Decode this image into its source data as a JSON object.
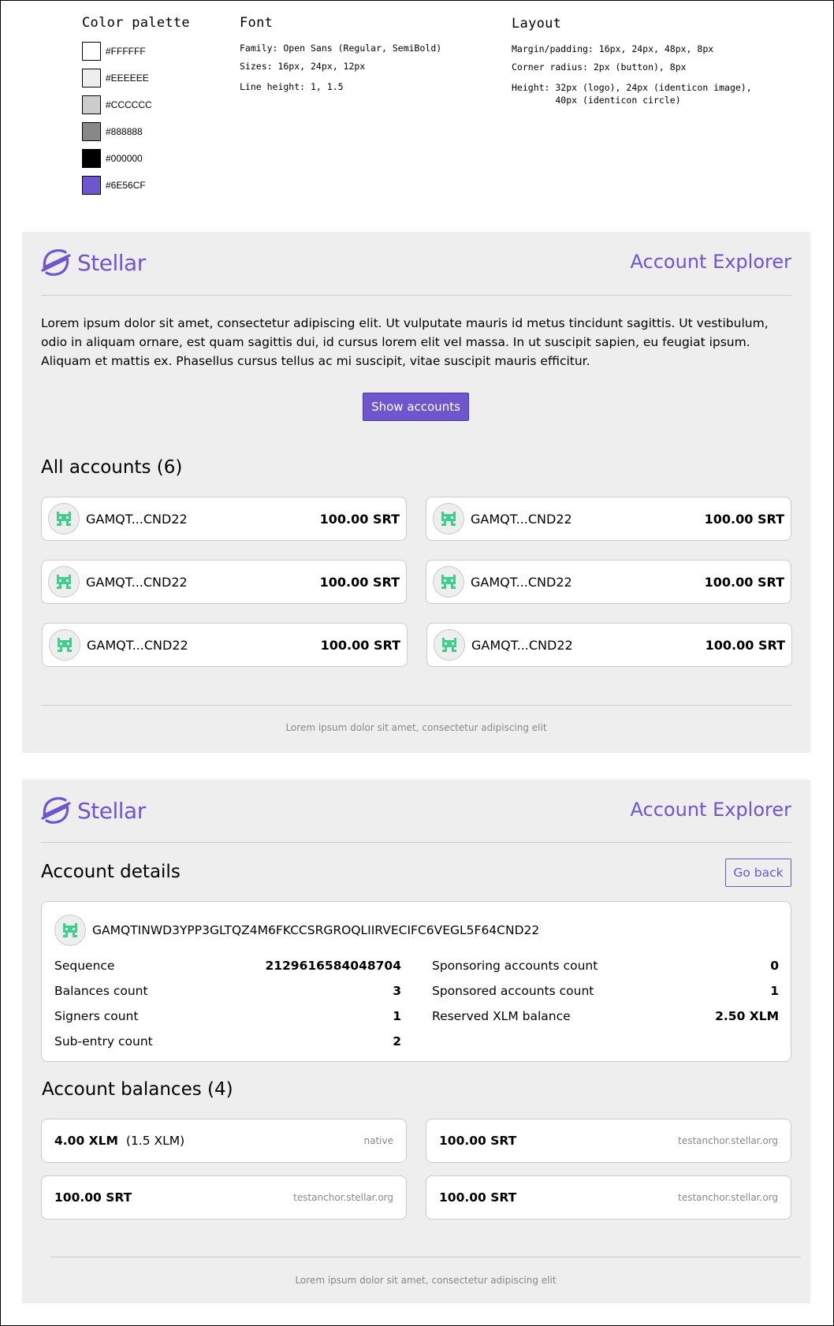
{
  "style_guide": {
    "palette_title": "Color palette",
    "colors": [
      {
        "hex": "#FFFFFF",
        "label": "#FFFFFF"
      },
      {
        "hex": "#EEEEEE",
        "label": "#EEEEEE"
      },
      {
        "hex": "#CCCCCC",
        "label": "#CCCCCC"
      },
      {
        "hex": "#888888",
        "label": "#888888"
      },
      {
        "hex": "#000000",
        "label": "#000000"
      },
      {
        "hex": "#6E56CF",
        "label": "#6E56CF"
      }
    ],
    "font_title": "Font",
    "font_family": "Family: Open Sans (Regular, SemiBold)",
    "font_sizes": "Sizes: 16px, 24px, 12px",
    "font_line_height": "Line height: 1, 1.5",
    "layout_title": "Layout",
    "layout_margin": "Margin/padding: 16px, 24px, 48px, 8px",
    "layout_radius": "Corner radius: 2px (button), 8px",
    "layout_height": "Height: 32px (logo), 24px (identicon image),\n        40px (identicon circle)"
  },
  "brand": {
    "logo_text": "Stellar",
    "app_title": "Account Explorer",
    "accent": "#6e56cf"
  },
  "home": {
    "intro": "Lorem ipsum dolor sit amet, consectetur adipiscing elit. Ut vulputate mauris id metus tincidunt sagittis. Ut vestibulum, odio in aliquam ornare, est quam sagittis dui, id cursus lorem elit vel massa. In ut suscipit sapien, eu feugiat ipsum. Aliquam et mattis ex. Phasellus cursus tellus ac mi suscipit, vitae suscipit mauris efficitur.",
    "show_button": "Show accounts",
    "accounts_heading": "All accounts (6)",
    "accounts": [
      {
        "id": "GAMQT...CND22",
        "balance": "100.00 SRT"
      },
      {
        "id": "GAMQT...CND22",
        "balance": "100.00 SRT"
      },
      {
        "id": "GAMQT...CND22",
        "balance": "100.00 SRT"
      },
      {
        "id": "GAMQT...CND22",
        "balance": "100.00 SRT"
      },
      {
        "id": "GAMQT...CND22",
        "balance": "100.00 SRT"
      },
      {
        "id": "GAMQT...CND22",
        "balance": "100.00 SRT"
      }
    ],
    "footer": "Lorem ipsum dolor sit amet, consectetur adipiscing elit"
  },
  "details": {
    "heading": "Account details",
    "back_button": "Go back",
    "account_id": "GAMQTINWD3YPP3GLTQZ4M6FKCCSRGROQLIIRVECIFC6VEGL5F64CND22",
    "left": [
      {
        "label": "Sequence",
        "value": "2129616584048704"
      },
      {
        "label": "Balances count",
        "value": "3"
      },
      {
        "label": "Signers count",
        "value": "1"
      },
      {
        "label": "Sub-entry count",
        "value": "2"
      }
    ],
    "right": [
      {
        "label": "Sponsoring accounts count",
        "value": "0"
      },
      {
        "label": "Sponsored accounts count",
        "value": "1"
      },
      {
        "label": "Reserved XLM balance",
        "value": "2.50 XLM"
      }
    ],
    "balances_heading": "Account balances (4)",
    "balances": [
      {
        "amount": "4.00 XLM",
        "extra": "(1.5 XLM)",
        "issuer": "native"
      },
      {
        "amount": "100.00 SRT",
        "extra": "",
        "issuer": "testanchor.stellar.org"
      },
      {
        "amount": "100.00 SRT",
        "extra": "",
        "issuer": "testanchor.stellar.org"
      },
      {
        "amount": "100.00 SRT",
        "extra": "",
        "issuer": "testanchor.stellar.org"
      }
    ],
    "footer": "Lorem ipsum dolor sit amet, consectetur adipiscing elit"
  }
}
